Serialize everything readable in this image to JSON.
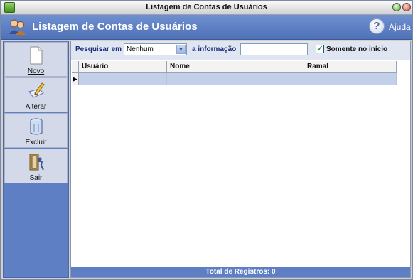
{
  "window": {
    "title": "Listagem de Contas de Usuários"
  },
  "header": {
    "title": "Listagem de Contas de Usuários",
    "help_label": "Ajuda"
  },
  "sidebar": {
    "items": [
      {
        "label": "Novo",
        "icon": "new-document-icon"
      },
      {
        "label": "Alterar",
        "icon": "edit-icon"
      },
      {
        "label": "Excluir",
        "icon": "trash-can-icon"
      },
      {
        "label": "Sair",
        "icon": "exit-door-icon"
      }
    ]
  },
  "search": {
    "field_label": "Pesquisar em",
    "field_value": "Nenhum",
    "info_label": "a informação",
    "info_value": "",
    "only_start_label": "Somente no início",
    "only_start_checked": true
  },
  "grid": {
    "columns": [
      "Usuário",
      "Nome",
      "Ramal"
    ],
    "rows": [
      [
        "",
        "",
        ""
      ]
    ]
  },
  "footer": {
    "total_label": "Total de Registros: 0"
  },
  "colors": {
    "accent": "#5f7fc4",
    "header": "#6f90cf",
    "selected_row": "#c3d0ea"
  }
}
